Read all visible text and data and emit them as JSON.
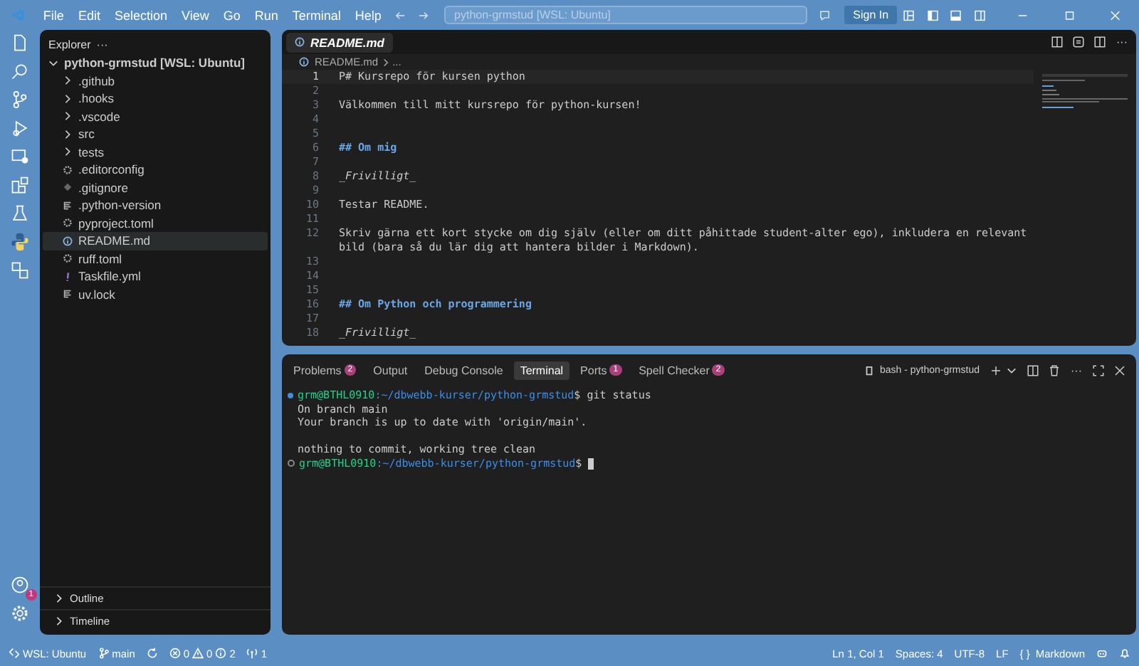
{
  "menu": [
    "File",
    "Edit",
    "Selection",
    "View",
    "Go",
    "Run",
    "Terminal",
    "Help"
  ],
  "command_center": {
    "placeholder": "python-grmstud [WSL: Ubuntu]"
  },
  "sign_in": "Sign In",
  "activity_bar": {
    "account_badge": "1"
  },
  "explorer": {
    "title": "Explorer",
    "more": "···",
    "tree": [
      {
        "label": "python-grmstud [WSL: Ubuntu]",
        "expanded": true,
        "children": [
          {
            "label": ".github",
            "kind": "folder",
            "expanded": false,
            "selected": false
          },
          {
            "label": ".hooks",
            "kind": "folder",
            "expanded": false,
            "selected": false
          },
          {
            "label": ".vscode",
            "kind": "folder",
            "expanded": false,
            "selected": false
          },
          {
            "label": "src",
            "kind": "folder",
            "expanded": false,
            "selected": false
          },
          {
            "label": "tests",
            "kind": "folder",
            "expanded": false,
            "selected": false
          },
          {
            "label": ".editorconfig",
            "kind": "config",
            "selected": false
          },
          {
            "label": ".gitignore",
            "kind": "ignore",
            "selected": false
          },
          {
            "label": ".python-version",
            "kind": "text",
            "selected": false
          },
          {
            "label": "pyproject.toml",
            "kind": "config",
            "selected": false
          },
          {
            "label": "README.md",
            "kind": "info",
            "selected": true
          },
          {
            "label": "ruff.toml",
            "kind": "config",
            "selected": false
          },
          {
            "label": "Taskfile.yml",
            "kind": "yaml",
            "selected": false
          },
          {
            "label": "uv.lock",
            "kind": "text",
            "selected": false
          }
        ]
      }
    ],
    "sections": [
      {
        "label": "Outline",
        "expanded": false
      },
      {
        "label": "Timeline",
        "expanded": false
      }
    ]
  },
  "editor": {
    "tab": "README.md",
    "breadcrumb": [
      "README.md",
      "..."
    ],
    "lines": [
      {
        "num": "1",
        "text": "P# Kursrepo för kursen python",
        "kind": "plain",
        "current": true
      },
      {
        "num": "2",
        "current": false
      },
      {
        "num": "3",
        "text": "Välkommen till mitt kursrepo för python-kursen!",
        "kind": "plain",
        "current": false
      },
      {
        "num": "4",
        "current": false
      },
      {
        "num": "5",
        "current": false
      },
      {
        "num": "6",
        "text": "## Om mig",
        "kind": "heading",
        "current": false
      },
      {
        "num": "7",
        "current": false
      },
      {
        "num": "8",
        "text": "_Frivilligt_",
        "kind": "italic",
        "current": false
      },
      {
        "num": "9",
        "current": false
      },
      {
        "num": "10",
        "text": "Testar README.",
        "kind": "plain",
        "current": false
      },
      {
        "num": "11",
        "current": false
      },
      {
        "num": "12",
        "text": "Skriv gärna ett kort stycke om dig själv (eller om ditt påhittade student-alter ego), inkludera en relevant bild (bara så du lär dig att hantera bilder i Markdown).",
        "kind": "plain",
        "current": false
      },
      {
        "num": "13",
        "current": false
      },
      {
        "num": "14",
        "current": false
      },
      {
        "num": "15",
        "current": false
      },
      {
        "num": "16",
        "text": "## Om Python och programmering",
        "kind": "heading",
        "current": false
      },
      {
        "num": "17",
        "current": false
      },
      {
        "num": "18",
        "text": "_Frivilligt_",
        "kind": "italic",
        "current": false
      }
    ]
  },
  "panel": {
    "tabs": [
      {
        "label": "Problems",
        "badge": "2",
        "selected": false
      },
      {
        "label": "Output",
        "selected": false
      },
      {
        "label": "Debug Console",
        "selected": false
      },
      {
        "label": "Terminal",
        "selected": true
      },
      {
        "label": "Ports",
        "badge": "1",
        "selected": false
      },
      {
        "label": "Spell Checker",
        "badge": "2",
        "selected": false
      }
    ],
    "terminal_name": "bash - python-grmstud",
    "more": "···",
    "terminal": [
      {
        "kind": "prompt",
        "user": "grm@BTHL0910",
        "path": ":~/dbwebb-kurser/python-grmstud",
        "command": "$ git status",
        "completed": true
      },
      {
        "kind": "output",
        "text": "On branch main"
      },
      {
        "kind": "output",
        "text": "Your branch is up to date with 'origin/main'."
      },
      {
        "kind": "output"
      },
      {
        "kind": "output",
        "text": "nothing to commit, working tree clean"
      },
      {
        "kind": "prompt",
        "user": "grm@BTHL0910",
        "path": ":~/dbwebb-kurser/python-grmstud",
        "command": "$",
        "completed": false
      }
    ]
  },
  "status_bar": {
    "remote": "WSL: Ubuntu",
    "branch": "main",
    "errors": "0",
    "warnings": "0",
    "infos": "2",
    "ports": "1",
    "right": [
      "Ln 1, Col 1",
      "Spaces: 4",
      "UTF-8",
      "LF"
    ],
    "braces": "{ }",
    "language": "Markdown"
  }
}
